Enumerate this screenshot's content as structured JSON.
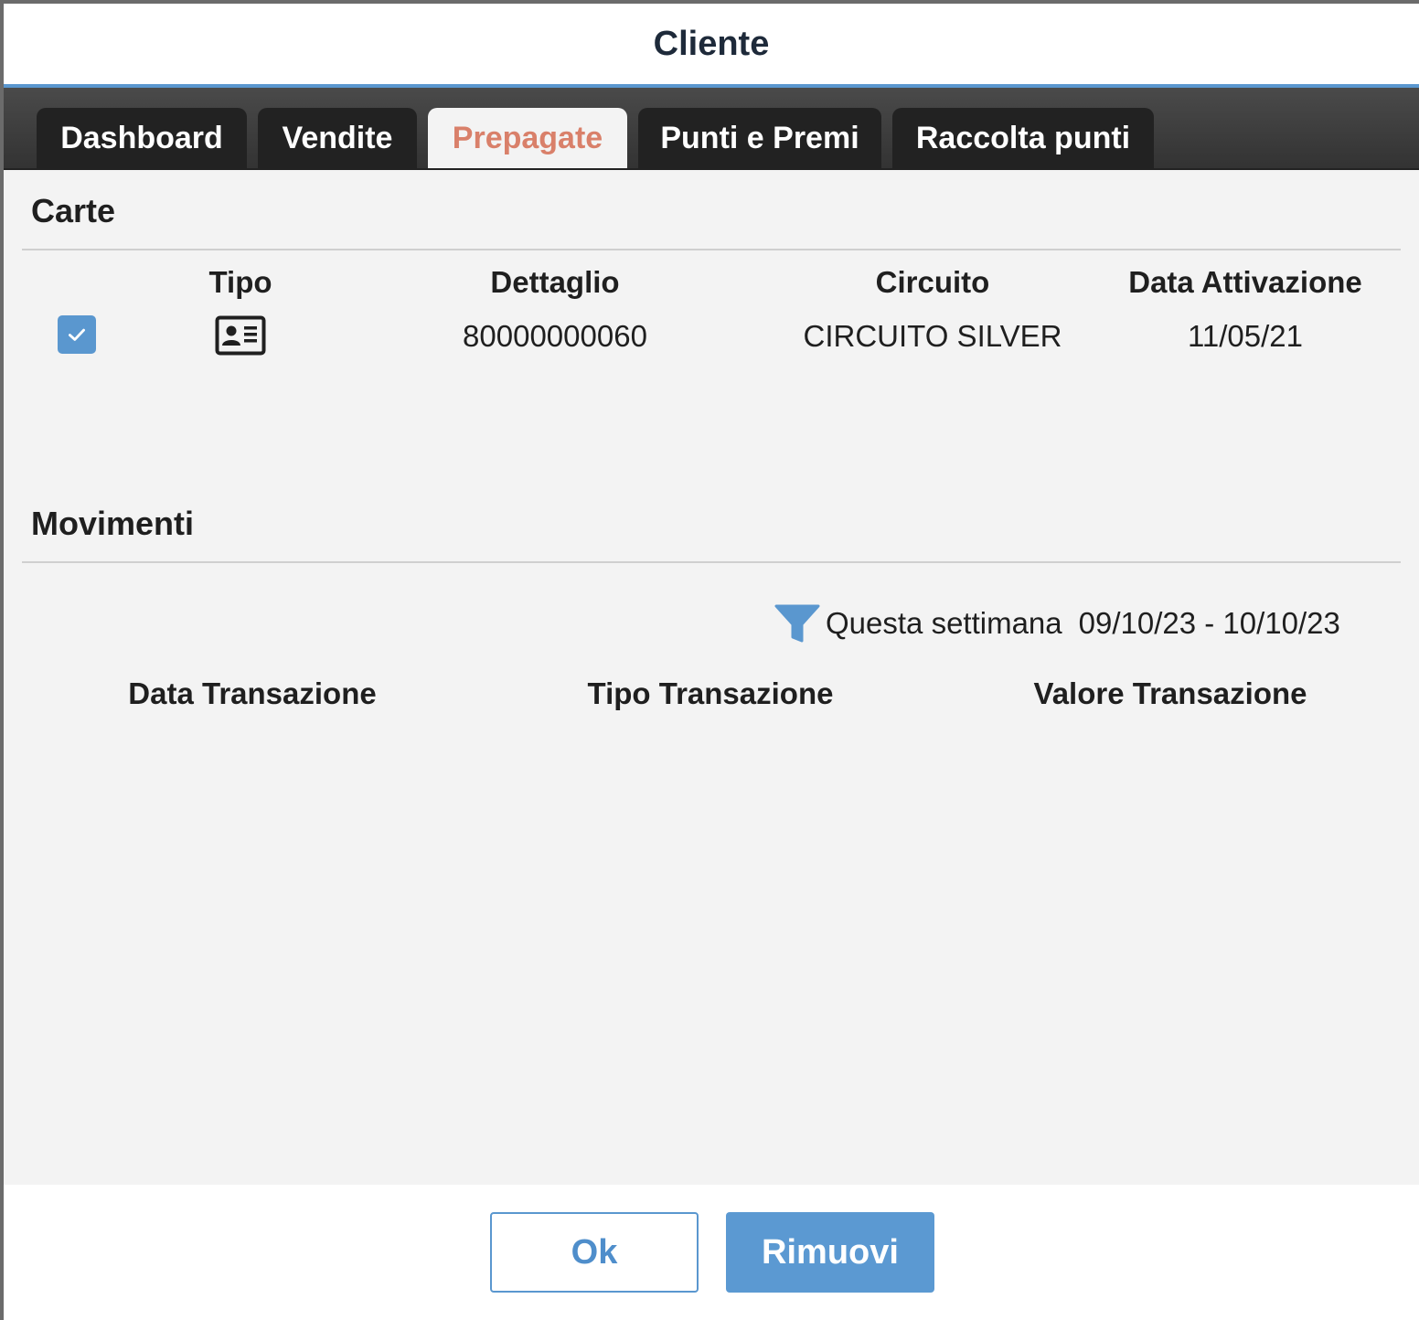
{
  "dialog": {
    "title": "Cliente"
  },
  "tabs": [
    {
      "label": "Dashboard",
      "active": false
    },
    {
      "label": "Vendite",
      "active": false
    },
    {
      "label": "Prepagate",
      "active": true
    },
    {
      "label": "Punti e Premi",
      "active": false
    },
    {
      "label": "Raccolta punti",
      "active": false
    }
  ],
  "carte": {
    "title": "Carte",
    "headers": {
      "tipo": "Tipo",
      "dettaglio": "Dettaglio",
      "circuito": "Circuito",
      "data_attivazione": "Data Attivazione"
    },
    "rows": [
      {
        "selected": true,
        "tipo_icon": "id-card-icon",
        "dettaglio": "80000000060",
        "circuito": "CIRCUITO SILVER",
        "data_attivazione": "11/05/21"
      }
    ]
  },
  "movimenti": {
    "title": "Movimenti",
    "filter": {
      "icon": "filter-icon",
      "label": "Questa settimana",
      "range": "09/10/23 - 10/10/23"
    },
    "headers": {
      "data": "Data Transazione",
      "tipo": "Tipo Transazione",
      "valore": "Valore Transazione"
    },
    "rows": []
  },
  "footer": {
    "ok_label": "Ok",
    "remove_label": "Rimuovi"
  },
  "colors": {
    "accent": "#5a97cf",
    "active_tab": "#d9806a",
    "tab_bg": "#222222"
  }
}
